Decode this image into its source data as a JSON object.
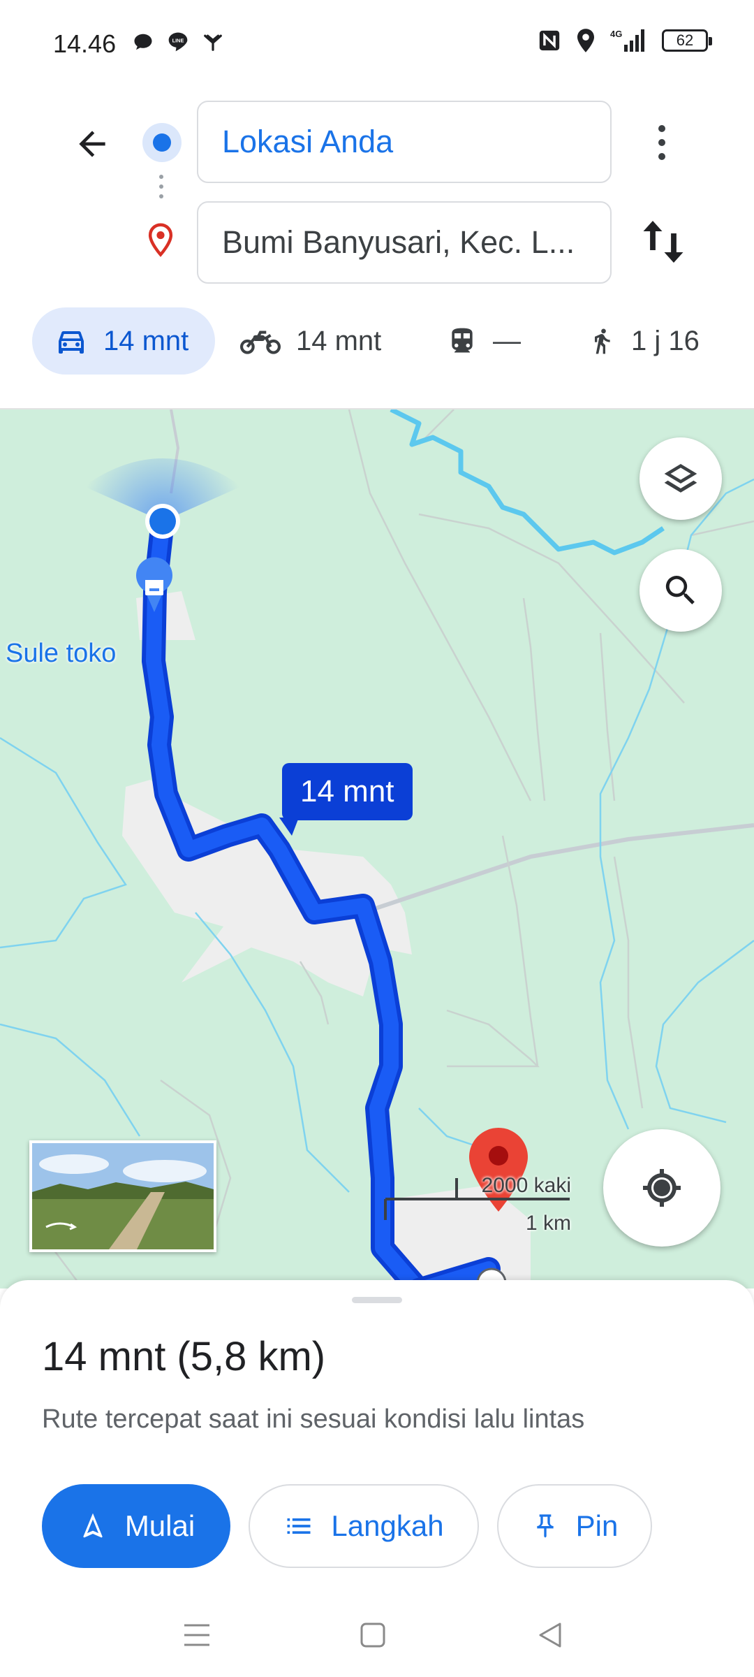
{
  "status_bar": {
    "time": "14.46",
    "left_icons": [
      "chat-bubble-icon",
      "line-app-icon",
      "antenna-icon"
    ],
    "right_icons": [
      "nfc-icon",
      "location-icon",
      "signal-4g-icon"
    ],
    "network": "4G",
    "battery": "62"
  },
  "directions": {
    "origin": "Lokasi Anda",
    "destination": "Bumi Banyusari, Kec. L..."
  },
  "modes": [
    {
      "id": "car",
      "icon": "car-icon",
      "label": "14 mnt",
      "selected": true
    },
    {
      "id": "motorcycle",
      "icon": "motorcycle-icon",
      "label": "14 mnt",
      "selected": false
    },
    {
      "id": "transit",
      "icon": "train-icon",
      "label": "—",
      "selected": false
    },
    {
      "id": "walk",
      "icon": "walking-icon",
      "label": "1 j 16",
      "selected": false
    }
  ],
  "map": {
    "poi_label": "Sule toko",
    "eta_bubble": "14 mnt",
    "scale_imperial": "2000 kaki",
    "scale_metric": "1 km",
    "colors": {
      "land": "#cfeedc",
      "route": "#1a5cf5",
      "route_outline": "#0b3fd6",
      "water": "#5cc8ee",
      "settlement": "#eeeeee",
      "destination_pin": "#ea4335"
    }
  },
  "sheet": {
    "summary": "14 mnt (5,8 km)",
    "description": "Rute tercepat saat ini sesuai kondisi lalu lintas",
    "buttons": {
      "start": "Mulai",
      "steps": "Langkah",
      "pin": "Pin"
    }
  },
  "accent_color": "#1a73e8"
}
